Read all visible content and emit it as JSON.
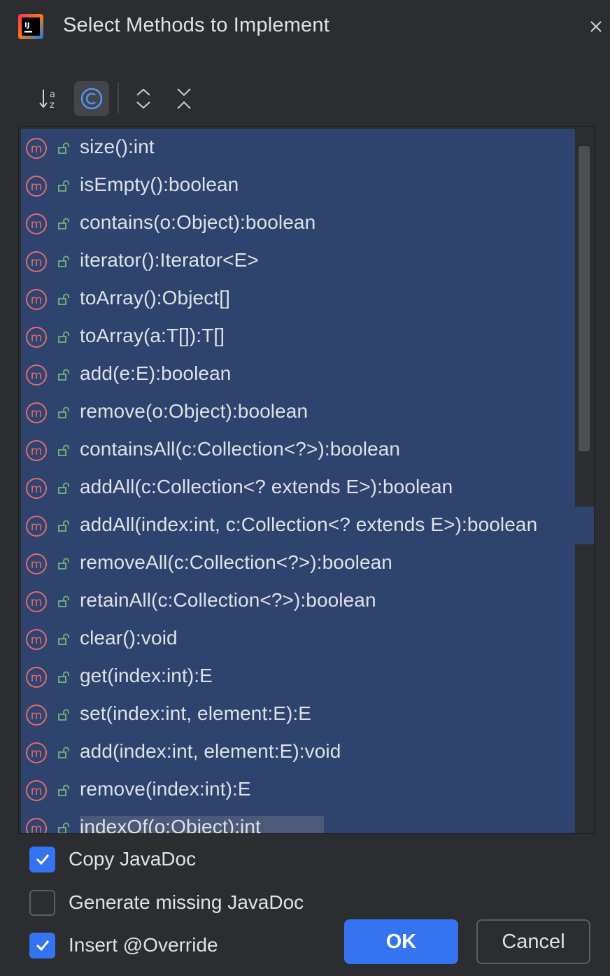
{
  "window": {
    "title": "Select Methods to Implement",
    "app_icon": "intellij-idea-logo",
    "close_icon": "close-icon"
  },
  "toolbar": {
    "buttons": [
      {
        "name": "sort-alphabetically",
        "icon": "sort-az-icon",
        "active": false
      },
      {
        "name": "show-classes",
        "icon": "class-c-icon",
        "active": true
      },
      {
        "name": "expand-all",
        "icon": "expand-all-icon",
        "active": false
      },
      {
        "name": "collapse-all",
        "icon": "collapse-all-icon",
        "active": false
      }
    ]
  },
  "methods": [
    "size():int",
    "isEmpty():boolean",
    "contains(o:Object):boolean",
    "iterator():Iterator<E>",
    "toArray():Object[]",
    "toArray(a:T[]):T[]",
    "add(e:E):boolean",
    "remove(o:Object):boolean",
    "containsAll(c:Collection<?>):boolean",
    "addAll(c:Collection<? extends E>):boolean",
    "addAll(index:int, c:Collection<? extends E>):boolean",
    "removeAll(c:Collection<?>):boolean",
    "retainAll(c:Collection<?>):boolean",
    "clear():void",
    "get(index:int):E",
    "set(index:int, element:E):E",
    "add(index:int, element:E):void",
    "remove(index:int):E",
    "indexOf(o:Object):int"
  ],
  "options": {
    "copy_javadoc": {
      "label": "Copy JavaDoc",
      "checked": true
    },
    "generate_missing_javadoc": {
      "label": "Generate missing JavaDoc",
      "checked": false
    },
    "insert_override": {
      "label": "Insert @Override",
      "checked": true
    }
  },
  "buttons": {
    "ok": "OK",
    "cancel": "Cancel"
  },
  "colors": {
    "background": "#2b2d30",
    "selection": "#2e436e",
    "accent": "#3574f0",
    "method_icon": "#e06c6c",
    "lock_icon": "#6aab73"
  }
}
